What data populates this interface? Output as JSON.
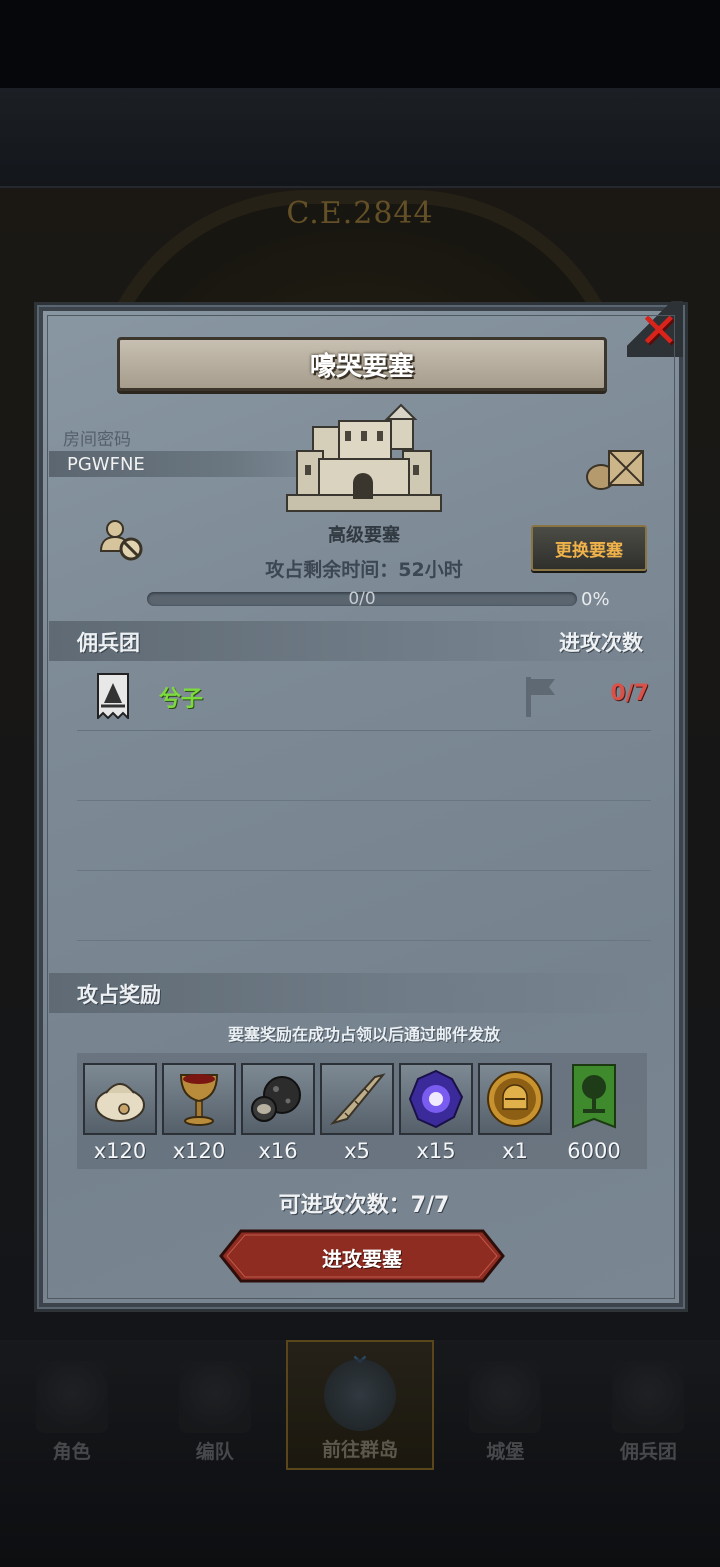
{
  "background": {
    "era_label": "C.E.2844"
  },
  "modal": {
    "title": "嚎哭要塞",
    "room_code_label": "房间密码",
    "room_code": "PGWFNE",
    "fortress_name": "高级要塞",
    "change_fortress_label": "更换要塞",
    "occupy_time_text": "攻占剩余时间：52小时",
    "progress": {
      "count_text": "0/0",
      "percent_text": "0%",
      "fraction": 0
    },
    "table": {
      "col_mercenary": "佣兵团",
      "col_attacks": "进攻次数",
      "rows": [
        {
          "name": "兮子",
          "attacks": "0/7",
          "name_color": "#7cdb3c",
          "attacks_color": "#d8524a"
        }
      ]
    },
    "rewards": {
      "title": "攻占奖励",
      "note": "要塞奖励在成功占领以后通过邮件发放",
      "items": [
        {
          "icon": "pouch-icon",
          "qty": "x120"
        },
        {
          "icon": "goblet-icon",
          "qty": "x120"
        },
        {
          "icon": "ore-icon",
          "qty": "x16"
        },
        {
          "icon": "horn-icon",
          "qty": "x5"
        },
        {
          "icon": "magic-crystal-icon",
          "qty": "x15"
        },
        {
          "icon": "knight-helmet-coin-icon",
          "qty": "x1"
        },
        {
          "icon": "guild-tree-banner-icon",
          "qty": "6000"
        }
      ]
    },
    "remaining_attacks_text": "可进攻次数：7/7",
    "attack_button_label": "进攻要塞"
  },
  "bottom_nav": {
    "items": [
      {
        "label": "角色",
        "icon": "character-icon"
      },
      {
        "label": "编队",
        "icon": "formation-icon"
      },
      {
        "label": "前往群岛",
        "icon": "islands-icon",
        "active": true
      },
      {
        "label": "城堡",
        "icon": "castle-icon"
      },
      {
        "label": "佣兵团",
        "icon": "mercenary-icon"
      }
    ]
  },
  "colors": {
    "accent_gold": "#f0b24a",
    "close_red": "#d9241c",
    "button_red": "#8e2c22"
  }
}
